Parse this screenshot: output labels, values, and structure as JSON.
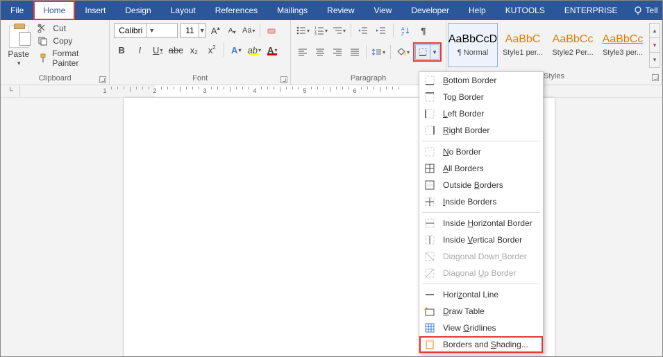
{
  "menu": {
    "file": "File",
    "home": "Home",
    "insert": "Insert",
    "design": "Design",
    "layout": "Layout",
    "references": "References",
    "mailings": "Mailings",
    "review": "Review",
    "view": "View",
    "developer": "Developer",
    "help": "Help",
    "kutools": "KUTOOLS",
    "enterprise": "ENTERPRISE",
    "tell": "Tell"
  },
  "clipboard": {
    "paste": "Paste",
    "cut": "Cut",
    "copy": "Copy",
    "format_painter": "Format Painter",
    "group": "Clipboard"
  },
  "font": {
    "name": "Calibri",
    "size": "11",
    "group": "Font"
  },
  "paragraph": {
    "group": "Paragraph"
  },
  "styles": {
    "group": "Styles",
    "items": [
      {
        "preview": "AaBbCcD",
        "name": "¶ Normal",
        "cls": "",
        "sel": true
      },
      {
        "preview": "AaBbC",
        "name": "Style1 per...",
        "cls": "style-orange",
        "sel": false
      },
      {
        "preview": "AaBbCc",
        "name": "Style2 Per...",
        "cls": "style-orange",
        "sel": false
      },
      {
        "preview": "AaBbCc",
        "name": "Style3 per...",
        "cls": "style-underline",
        "sel": false
      }
    ]
  },
  "ruler": {
    "numbers": [
      1,
      2,
      3,
      4,
      5,
      6
    ]
  },
  "borders_menu": [
    {
      "label": "Bottom Border",
      "u": 0,
      "type": "item"
    },
    {
      "label": "Top Border",
      "u": 2,
      "type": "item"
    },
    {
      "label": "Left Border",
      "u": 0,
      "type": "item"
    },
    {
      "label": "Right Border",
      "u": 0,
      "type": "item"
    },
    {
      "type": "sep"
    },
    {
      "label": "No Border",
      "u": 0,
      "type": "item"
    },
    {
      "label": "All Borders",
      "u": 0,
      "type": "item"
    },
    {
      "label": "Outside Borders",
      "u": 8,
      "type": "item"
    },
    {
      "label": "Inside Borders",
      "u": 0,
      "type": "item"
    },
    {
      "type": "sep"
    },
    {
      "label": "Inside Horizontal Border",
      "u": 7,
      "type": "item"
    },
    {
      "label": "Inside Vertical Border",
      "u": 7,
      "type": "item"
    },
    {
      "label": "Diagonal Down Border",
      "u": 13,
      "type": "item",
      "disabled": true
    },
    {
      "label": "Diagonal Up Border",
      "u": 9,
      "type": "item",
      "disabled": true
    },
    {
      "type": "sep"
    },
    {
      "label": "Horizontal Line",
      "u": 4,
      "type": "item"
    },
    {
      "label": "Draw Table",
      "u": 0,
      "type": "item"
    },
    {
      "label": "View Gridlines",
      "u": 5,
      "type": "item"
    },
    {
      "label": "Borders and Shading...",
      "u": 12,
      "type": "item",
      "highlight": true
    }
  ]
}
